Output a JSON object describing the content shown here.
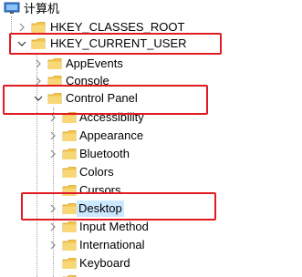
{
  "root": {
    "label": "计算机",
    "icon": "computer-icon"
  },
  "hives": [
    {
      "label": "HKEY_CLASSES_ROOT",
      "expanded": false
    },
    {
      "label": "HKEY_CURRENT_USER",
      "expanded": true
    }
  ],
  "hkcu_children": [
    {
      "label": "AppEvents",
      "expanded": false
    },
    {
      "label": "Console",
      "expanded": false
    },
    {
      "label": "Control Panel",
      "expanded": true
    }
  ],
  "control_panel_children": [
    {
      "label": "Accessibility",
      "has_children": true
    },
    {
      "label": "Appearance",
      "has_children": true
    },
    {
      "label": "Bluetooth",
      "has_children": true
    },
    {
      "label": "Colors",
      "has_children": false
    },
    {
      "label": "Cursors",
      "has_children": false
    },
    {
      "label": "Desktop",
      "has_children": true,
      "selected": true
    },
    {
      "label": "Input Method",
      "has_children": true
    },
    {
      "label": "International",
      "has_children": true
    },
    {
      "label": "Keyboard",
      "has_children": false
    }
  ],
  "colors": {
    "highlight_border": "#e11b22",
    "selection_background": "#cce8ff",
    "folder": "#f3c54a",
    "tree_lines": "#a0a0a0"
  }
}
